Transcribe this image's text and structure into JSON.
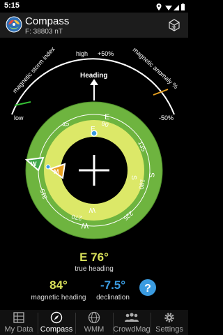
{
  "status_bar": {
    "time": "5:15"
  },
  "app_bar": {
    "title": "Compass",
    "subtitle": "F: 38803 nT"
  },
  "gauges": {
    "storm": {
      "label": "magnetic storm index",
      "high": "high",
      "low": "low"
    },
    "anomaly": {
      "label": "magnetic anomaly %",
      "plus": "+50%",
      "minus": "-50%"
    },
    "heading_label": "Heading"
  },
  "compass": {
    "outer_labels": [
      "E",
      "45",
      "90",
      "135",
      "S",
      "180",
      "225",
      "W",
      "270",
      "315"
    ],
    "inner_labels": [
      "E",
      "S",
      "W"
    ],
    "marker_w": "W",
    "marker_m": "M"
  },
  "readouts": {
    "true_heading_value": "E 76°",
    "true_heading_label": "true heading",
    "magnetic_heading_value": "84°",
    "magnetic_heading_label": "magnetic heading",
    "declination_value": "-7.5°",
    "declination_label": "declination",
    "help_symbol": "?"
  },
  "nav": {
    "items": [
      {
        "label": "My Data",
        "icon": "data-grid-icon"
      },
      {
        "label": "Compass",
        "icon": "compass-icon"
      },
      {
        "label": "WMM",
        "icon": "globe-icon"
      },
      {
        "label": "CrowdMag",
        "icon": "crowd-icon"
      },
      {
        "label": "Settings",
        "icon": "gear-icon"
      }
    ],
    "active_index": 1
  },
  "colors": {
    "outer_ring": "#6eb43f",
    "inner_ring": "#dce868",
    "value_yellow": "#d8e05a",
    "value_blue": "#3a9be0",
    "gauge_green": "#35c135",
    "gauge_orange": "#e8a020"
  }
}
